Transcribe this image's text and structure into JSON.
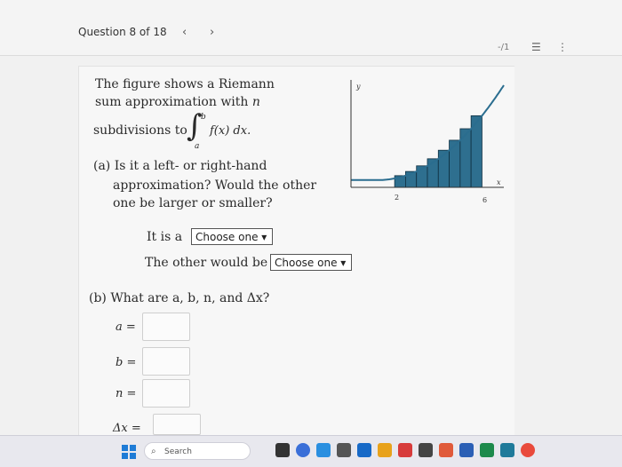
{
  "header": {
    "question_label": "Question 8 of 18",
    "prev_arrow": "‹",
    "next_arrow": "›",
    "score": "-/1",
    "list_icon_glyph": "☰",
    "more_icon_glyph": "⋮"
  },
  "question": {
    "line1": "The figure shows a Riemann",
    "line2_pre": "sum approximation with ",
    "line2_var": "n",
    "line3_pre": "subdivisions to",
    "integral_sign": "∫",
    "upper_limit": "b",
    "lower_limit": "a",
    "integrand": "f(x) dx.",
    "part_a_line1": "(a) Is it a left- or right-hand",
    "part_a_line2": "approximation? Would the other",
    "part_a_line3": "one be larger or smaller?",
    "it_is_label": "It is a",
    "other_label": "The other would be",
    "dropdown1": "Choose one ▾",
    "dropdown2": "Choose one ▾",
    "part_b": "(b) What are a, b, n, and Δx?",
    "a_label": "a =",
    "b_label": "b =",
    "n_label": "n =",
    "dx_label": "Δx ="
  },
  "graph": {
    "y_label": "y",
    "x_label": "x",
    "tick_2": "2",
    "tick_6": "6",
    "fill_color": "#2e6f8f",
    "curve_color": "#2a6d8f",
    "x_range": [
      0,
      7
    ],
    "rect_starts": [
      2,
      2.5,
      3,
      3.5,
      4,
      4.5,
      5,
      5.5
    ]
  },
  "taskbar": {
    "search_text": "Search",
    "search_icon": "search-icon"
  }
}
